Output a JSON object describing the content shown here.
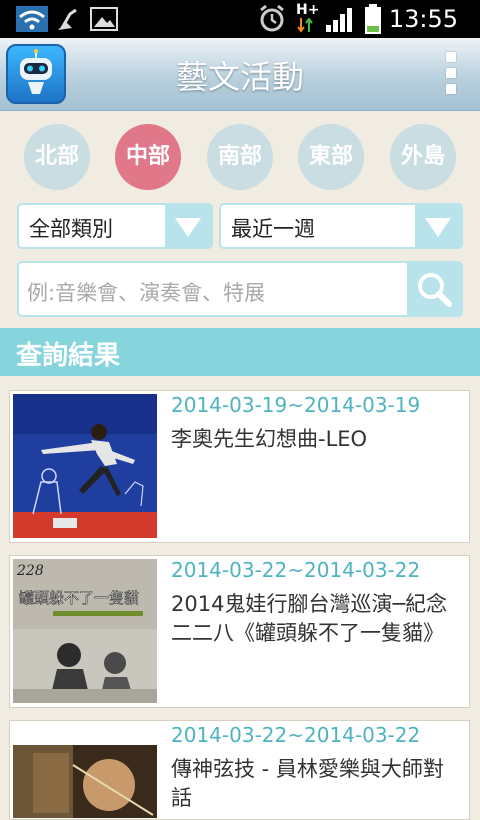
{
  "status_bar": {
    "time": "13:55",
    "network": "H+"
  },
  "app_bar": {
    "title": "藝文活動"
  },
  "regions": [
    {
      "label": "北部",
      "active": false
    },
    {
      "label": "中部",
      "active": true
    },
    {
      "label": "南部",
      "active": false
    },
    {
      "label": "東部",
      "active": false
    },
    {
      "label": "外島",
      "active": false
    }
  ],
  "filters": {
    "category": "全部類別",
    "period": "最近一週"
  },
  "search": {
    "placeholder": "例:音樂會、演奏會、特展"
  },
  "results": {
    "header": "查詢結果",
    "items": [
      {
        "date": "2014-03-19~2014-03-19",
        "title": "李奧先生幻想曲-LEO"
      },
      {
        "date": "2014-03-22~2014-03-22",
        "title": "2014鬼娃行腳台灣巡演─紀念二二八《罐頭躲不了一隻貓》"
      },
      {
        "date": "2014-03-22~2014-03-22",
        "title": "傳神弦技 - 員林愛樂與大師對話"
      }
    ]
  },
  "poster_texts": {
    "poster2_num": "228",
    "poster2_title": "罐頭躲不了一隻貓"
  },
  "colors": {
    "accent": "#86d4dc",
    "active_region": "#e0788a",
    "inactive_region": "#c9dde3",
    "date_text": "#4eb4c0"
  }
}
